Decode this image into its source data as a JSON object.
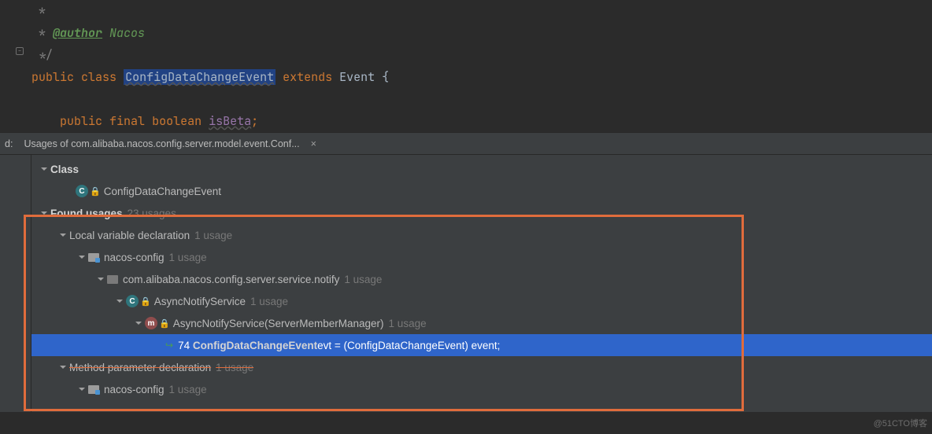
{
  "code": {
    "star1": " *",
    "anno_key": "@author",
    "anno_val": " Nacos",
    "star2": " */",
    "kw_public": "public",
    "kw_class": "class",
    "class_name": "ConfigDataChangeEvent",
    "kw_extends": "extends",
    "super_class": "Event",
    "brace": " {",
    "kw_public2": "public",
    "kw_final": "final",
    "kw_boolean": "boolean",
    "field": "isBeta",
    "semi": ";"
  },
  "pane": {
    "left_label": "d:",
    "tab_title": "Usages of com.alibaba.nacos.config.server.model.event.Conf...",
    "close": "×"
  },
  "tree": {
    "class_section": "Class",
    "class_item": "ConfigDataChangeEvent",
    "found_label": "Found usages",
    "found_count": "23 usages",
    "local_var": "Local variable declaration",
    "one_usage": "1 usage",
    "module": "nacos-config",
    "package": "com.alibaba.nacos.config.server.service.notify",
    "service_class": "AsyncNotifyService",
    "ctor": "AsyncNotifyService(ServerMemberManager)",
    "line_no": "74",
    "usage_line_pre": "ConfigDataChangeEvent",
    "usage_line_post": " evt = (ConfigDataChangeEvent) event;",
    "method_param": "Method parameter declaration",
    "module2": "nacos-config"
  },
  "watermark": "@51CTO博客"
}
